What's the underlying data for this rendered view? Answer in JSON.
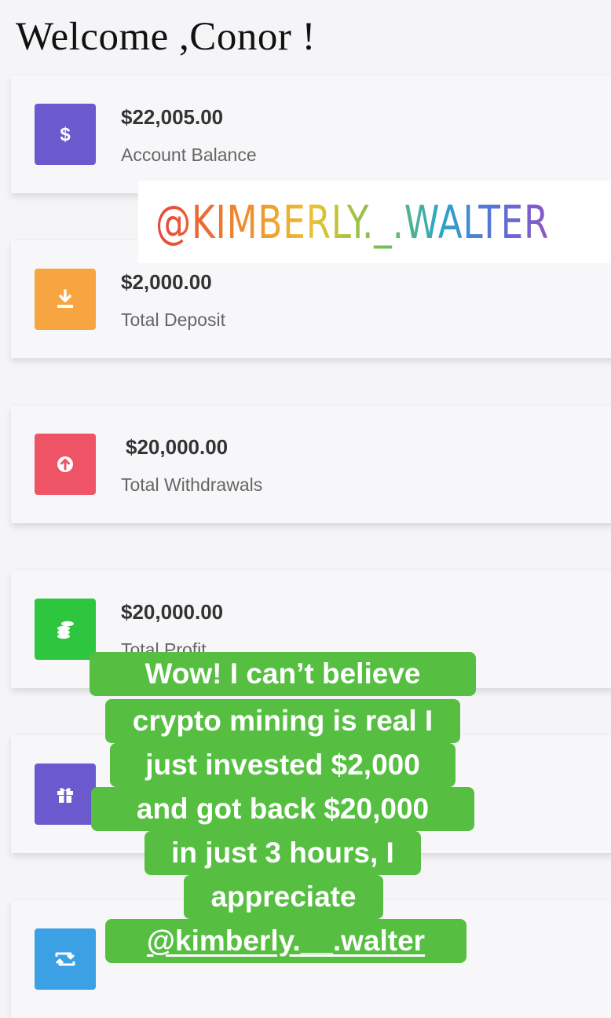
{
  "header": {
    "welcome": "Welcome ,Conor !"
  },
  "cards": [
    {
      "amount": "$22,005.00",
      "label": "Account Balance",
      "icon": "dollar-icon",
      "color": "#6a5acd"
    },
    {
      "amount": "$2,000.00",
      "label": "Total Deposit",
      "icon": "download-icon",
      "color": "#f7a540"
    },
    {
      "amount": "$20,000.00",
      "label": "Total Withdrawals",
      "icon": "upload-icon",
      "color": "#ef5466"
    },
    {
      "amount": "$20,000.00",
      "label": "Total Profit",
      "icon": "coins-icon",
      "color": "#2ec53f"
    },
    {
      "icon": "gift-icon",
      "color": "#6a5acd"
    },
    {
      "icon": "retweet-icon",
      "color": "#3ba0e4"
    }
  ],
  "overlay": {
    "tag": "@KIMBERLY._.WALTER",
    "bubble_color": "#56bf42",
    "lines": [
      "Wow! I can’t believe",
      "crypto mining is real I",
      "just invested $2,000",
      "and got back $20,000",
      "in just 3 hours, I",
      "appreciate",
      "@kimberly.__.walter"
    ]
  }
}
